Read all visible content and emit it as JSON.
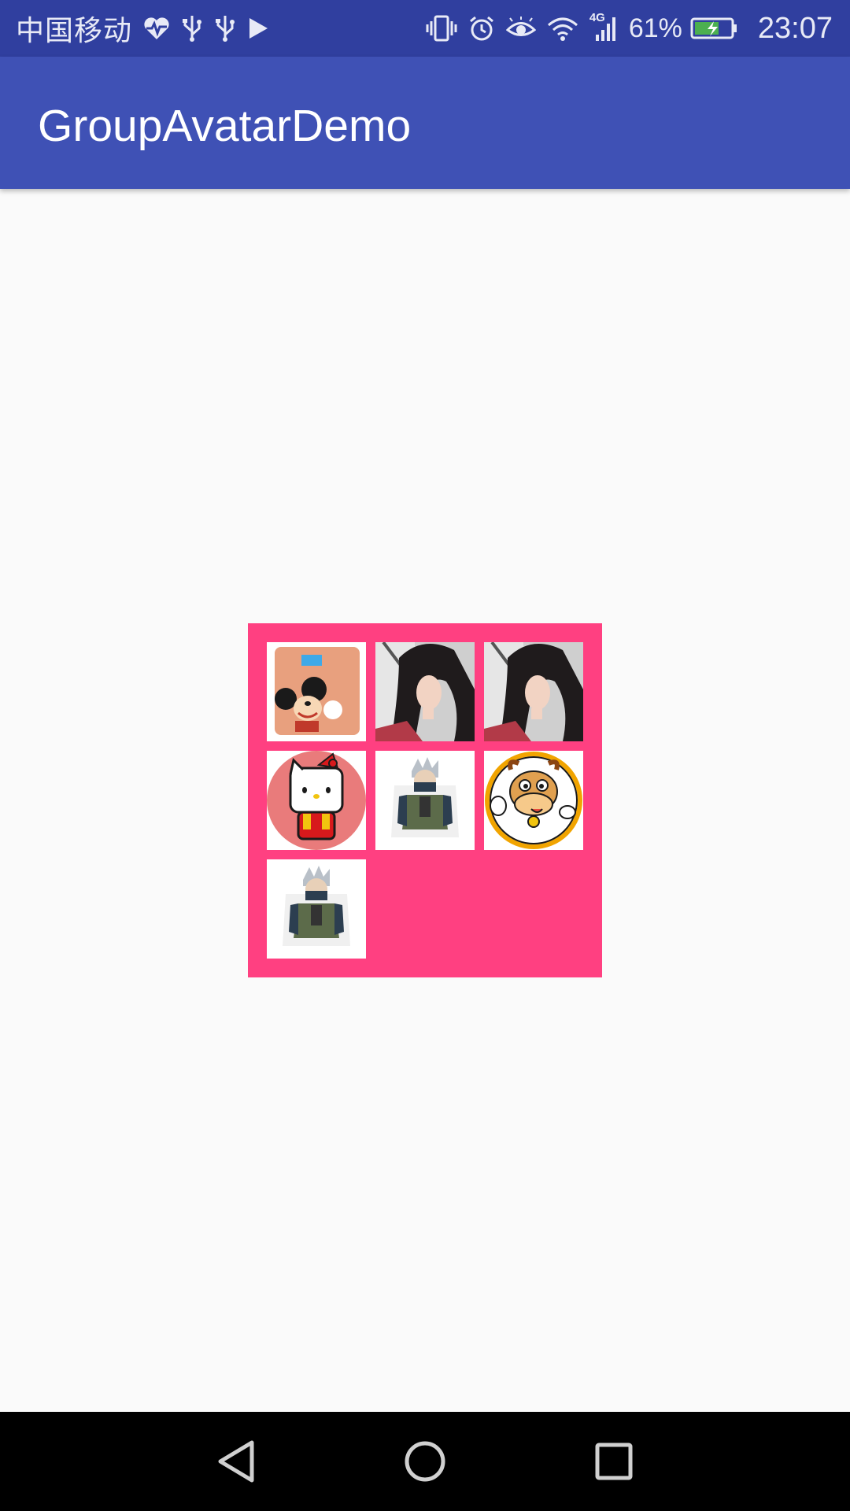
{
  "status_bar": {
    "carrier": "中国移动",
    "network_label": "4G",
    "battery_percent": "61%",
    "time": "23:07",
    "icons": [
      "heart-pulse-icon",
      "usb-icon",
      "usb-icon",
      "play-icon",
      "vibrate-icon",
      "alarm-icon",
      "eye-icon",
      "wifi-icon",
      "signal-icon",
      "battery-charging-icon"
    ]
  },
  "app_bar": {
    "title": "GroupAvatarDemo"
  },
  "group_avatar": {
    "background_color": "#ff4081",
    "tiles": [
      {
        "image": "mickey-scale-photo"
      },
      {
        "image": "woman-portrait-photo"
      },
      {
        "image": "woman-portrait-photo"
      },
      {
        "image": "hello-kitty-avatar"
      },
      {
        "image": "kakashi-figure-photo"
      },
      {
        "image": "cartoon-cow-avatar"
      },
      {
        "image": "kakashi-figure-photo"
      }
    ]
  },
  "nav_bar": {
    "buttons": [
      "back-icon",
      "home-icon",
      "recents-icon"
    ]
  },
  "colors": {
    "status_bar": "#303f9f",
    "app_bar": "#3f51b5",
    "background": "#fafafa",
    "accent": "#ff4081"
  }
}
